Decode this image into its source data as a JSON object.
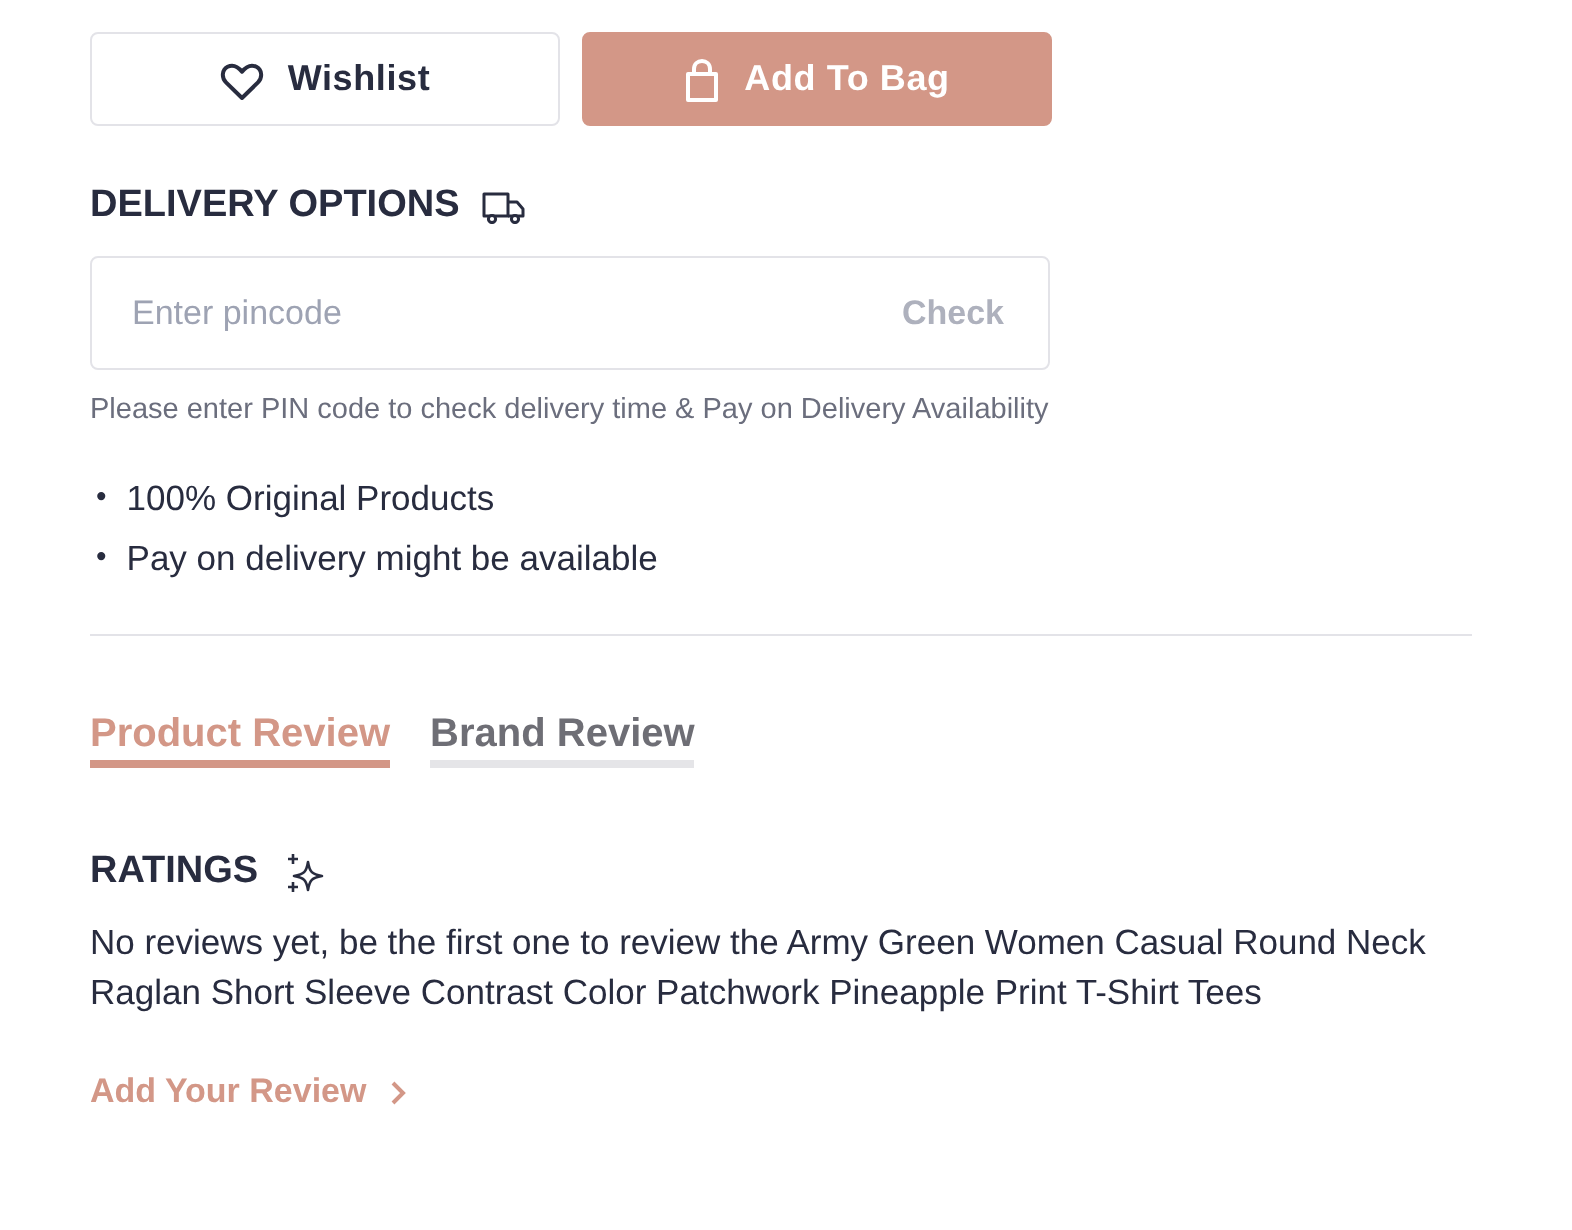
{
  "actions": [
    {
      "kind": "wishlist",
      "label": "Wishlist"
    },
    {
      "kind": "add_to_bag",
      "label": "Add To Bag"
    }
  ],
  "delivery": {
    "title": "DELIVERY OPTIONS",
    "pincode_field": {
      "placeholder": "Enter pincode"
    },
    "check_button": {
      "label": "Check",
      "disabled": true
    },
    "hint": "Please enter PIN code to check delivery time & Pay on Delivery Availability",
    "features": [
      {
        "bullet": "•",
        "text": "100% Original Products"
      },
      {
        "bullet": "•",
        "text": "Pay on delivery might be available"
      }
    ]
  },
  "review_tabs": [
    {
      "label": "Product Review",
      "selected": true
    },
    {
      "label": "Brand Review",
      "selected": false
    }
  ],
  "ratings": {
    "title": "RATINGS",
    "message": "No reviews yet, be the first one to review the Army Green Women Casual Round Neck Raglan Short Sleeve Contrast Color Patchwork Pineapple Print T-Shirt Tees",
    "link": "Add Your Review"
  }
}
